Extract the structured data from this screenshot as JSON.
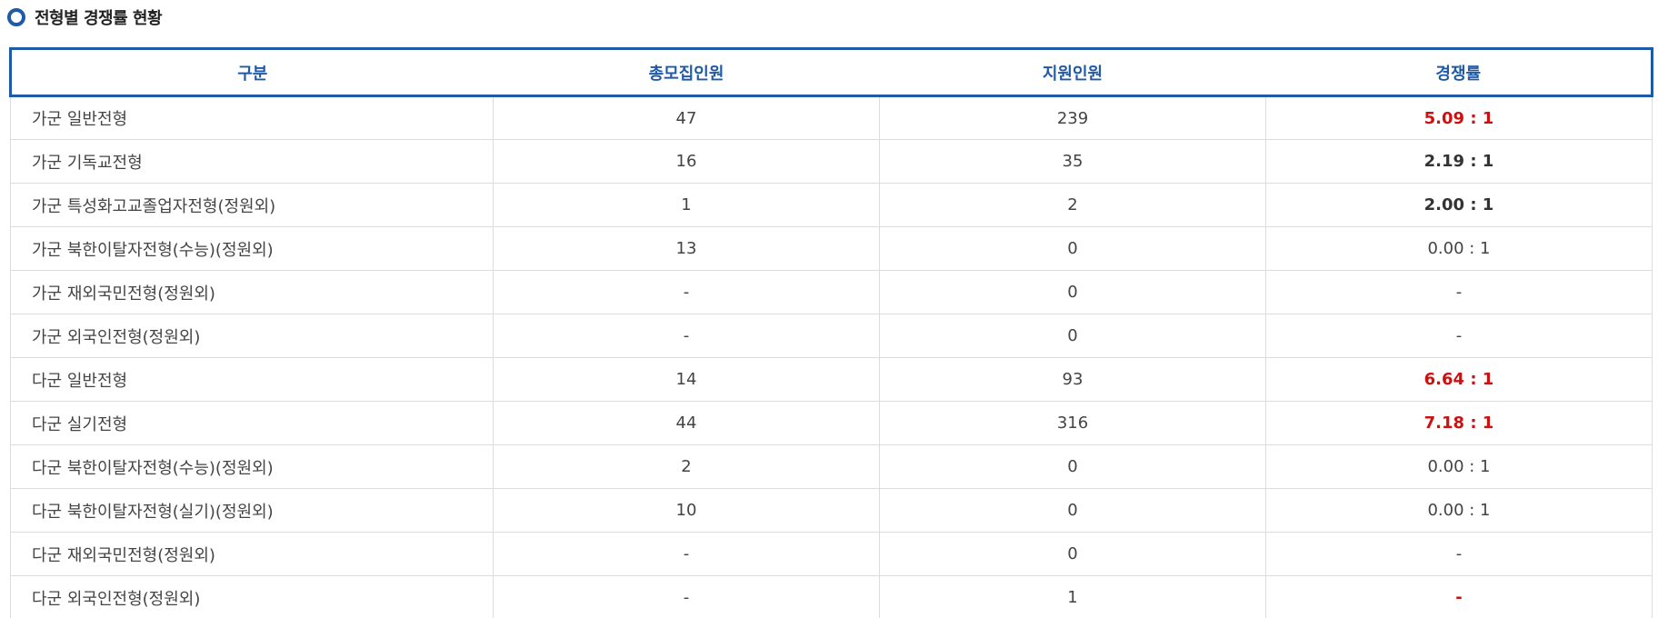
{
  "section": {
    "title": "전형별 경쟁률 현황"
  },
  "table": {
    "headers": [
      "구분",
      "총모집인원",
      "지원인원",
      "경쟁률"
    ],
    "rows": [
      {
        "category": "가군 일반전형",
        "quota": "47",
        "applicants": "239",
        "rate": "5.09 : 1",
        "rate_style": "high"
      },
      {
        "category": "가군 기독교전형",
        "quota": "16",
        "applicants": "35",
        "rate": "2.19 : 1",
        "rate_style": "emph"
      },
      {
        "category": "가군 특성화고교졸업자전형(정원외)",
        "quota": "1",
        "applicants": "2",
        "rate": "2.00 : 1",
        "rate_style": "emph"
      },
      {
        "category": "가군 북한이탈자전형(수능)(정원외)",
        "quota": "13",
        "applicants": "0",
        "rate": "0.00 : 1",
        "rate_style": "normal"
      },
      {
        "category": "가군 재외국민전형(정원외)",
        "quota": "-",
        "applicants": "0",
        "rate": "-",
        "rate_style": "normal"
      },
      {
        "category": "가군 외국인전형(정원외)",
        "quota": "-",
        "applicants": "0",
        "rate": "-",
        "rate_style": "normal"
      },
      {
        "category": "다군 일반전형",
        "quota": "14",
        "applicants": "93",
        "rate": "6.64 : 1",
        "rate_style": "high"
      },
      {
        "category": "다군 실기전형",
        "quota": "44",
        "applicants": "316",
        "rate": "7.18 : 1",
        "rate_style": "high"
      },
      {
        "category": "다군 북한이탈자전형(수능)(정원외)",
        "quota": "2",
        "applicants": "0",
        "rate": "0.00 : 1",
        "rate_style": "normal"
      },
      {
        "category": "다군 북한이탈자전형(실기)(정원외)",
        "quota": "10",
        "applicants": "0",
        "rate": "0.00 : 1",
        "rate_style": "normal"
      },
      {
        "category": "다군 재외국민전형(정원외)",
        "quota": "-",
        "applicants": "0",
        "rate": "-",
        "rate_style": "normal"
      },
      {
        "category": "다군 외국인전형(정원외)",
        "quota": "-",
        "applicants": "1",
        "rate": "-",
        "rate_style": "high"
      }
    ]
  },
  "colors": {
    "accent": "#1f5aa8",
    "high_rate": "#cc1111",
    "text": "#444444",
    "border": "#dcdcdc"
  },
  "icons": {
    "section_marker": "radio-circle-icon"
  }
}
